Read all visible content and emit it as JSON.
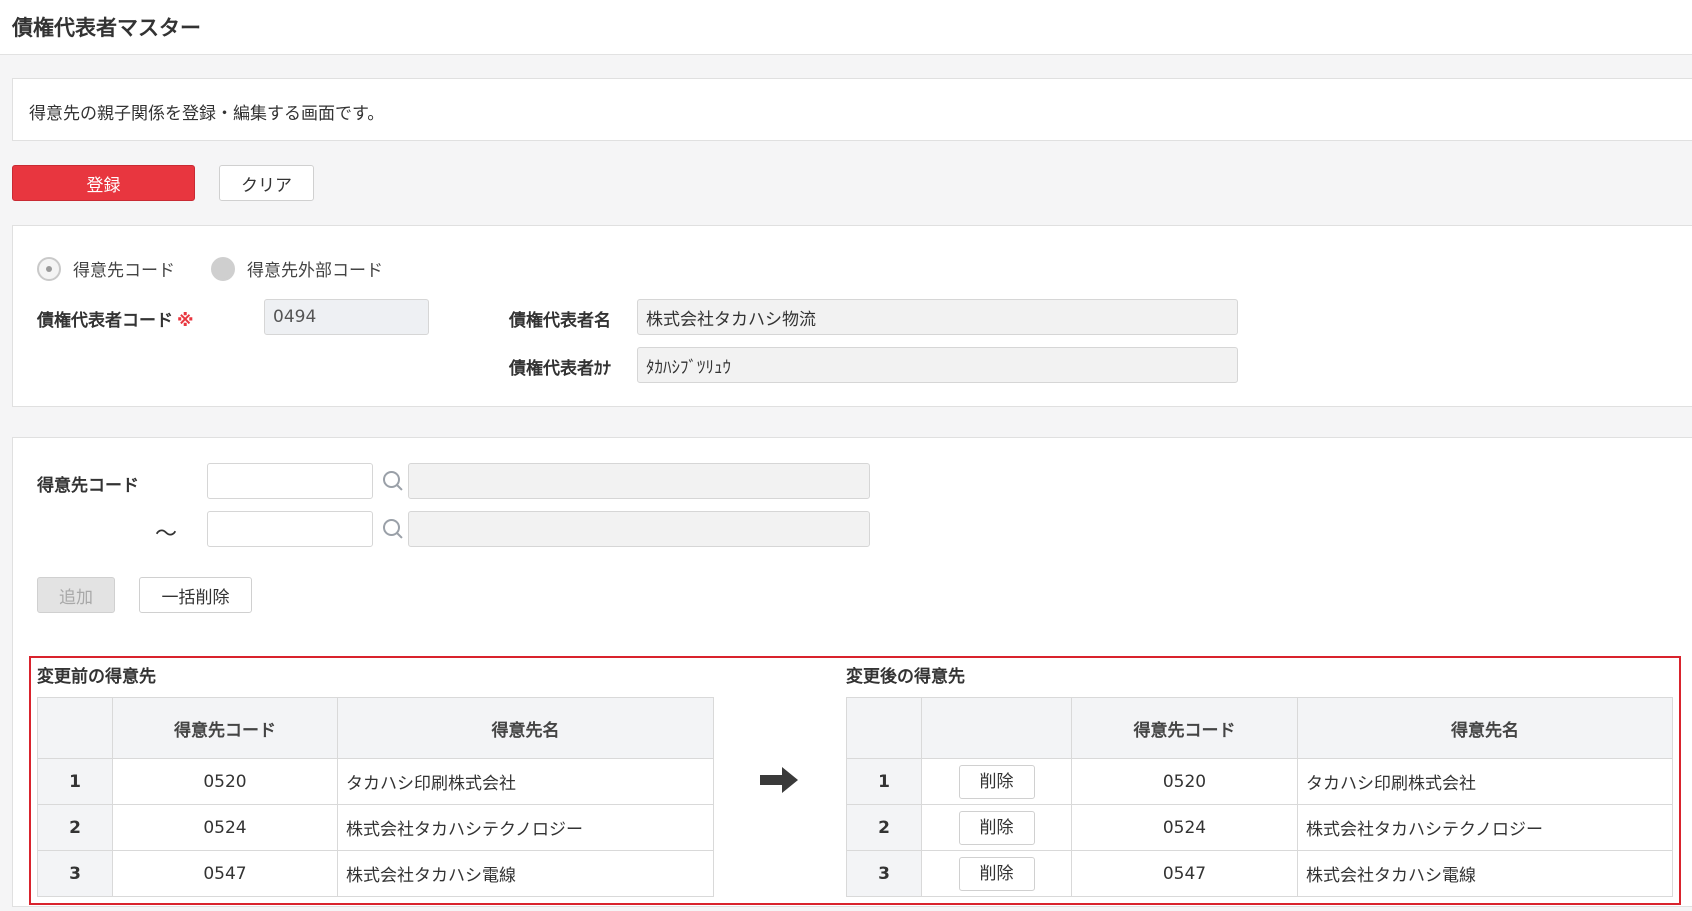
{
  "page": {
    "title": "債権代表者マスター",
    "description": "得意先の親子関係を登録・編集する画面です。"
  },
  "actions": {
    "register": "登録",
    "clear": "クリア"
  },
  "header_form": {
    "radio_customer_code": "得意先コード",
    "radio_external_code": "得意先外部コード",
    "rep_code_label": "債権代表者コード",
    "required_mark": "※",
    "rep_code_value": "0494",
    "rep_name_label": "債権代表者名",
    "rep_name_value": "株式会社タカハシ物流",
    "rep_kana_label": "債権代表者ｶﾅ",
    "rep_kana_value": "ﾀｶﾊｼﾌﾞﾂﾘｭｳ"
  },
  "range_form": {
    "customer_code_label": "得意先コード",
    "tilde": "～",
    "from_value": "",
    "to_value": "",
    "add": "追加",
    "bulk_delete": "一括削除"
  },
  "before_table": {
    "title": "変更前の得意先",
    "columns": [
      "",
      "得意先コード",
      "得意先名"
    ],
    "rows": [
      {
        "num": "1",
        "code": "0520",
        "name": "タカハシ印刷株式会社"
      },
      {
        "num": "2",
        "code": "0524",
        "name": "株式会社タカハシテクノロジー"
      },
      {
        "num": "3",
        "code": "0547",
        "name": "株式会社タカハシ電線"
      }
    ]
  },
  "after_table": {
    "title": "変更後の得意先",
    "columns": [
      "",
      "",
      "得意先コード",
      "得意先名"
    ],
    "delete_label": "削除",
    "rows": [
      {
        "num": "1",
        "code": "0520",
        "name": "タカハシ印刷株式会社"
      },
      {
        "num": "2",
        "code": "0524",
        "name": "株式会社タカハシテクノロジー"
      },
      {
        "num": "3",
        "code": "0547",
        "name": "株式会社タカハシ電線"
      }
    ]
  },
  "colors": {
    "primary": "#e8363f",
    "highlight_border": "#d9232d"
  }
}
